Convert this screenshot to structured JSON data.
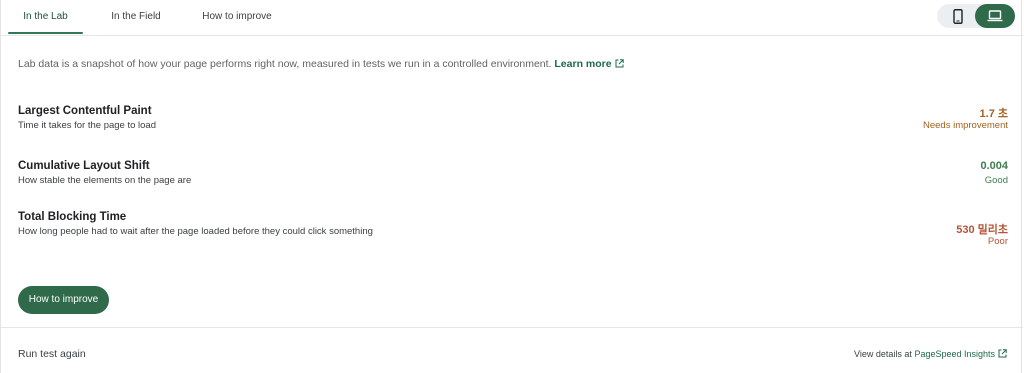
{
  "tabs": [
    {
      "label": "In the Lab",
      "active": true
    },
    {
      "label": "In the Field",
      "active": false
    },
    {
      "label": "How to improve",
      "active": false
    }
  ],
  "device_toggle": {
    "options": [
      {
        "icon": "smartphone-icon",
        "selected": false
      },
      {
        "icon": "laptop-icon",
        "selected": true
      }
    ]
  },
  "intro": {
    "text": "Lab data is a snapshot of how your page performs right now, measured in tests we run in a controlled environment.",
    "link_label": "Learn more",
    "link_icon": "external-link-icon"
  },
  "metrics": [
    {
      "title": "Largest Contentful Paint",
      "description": "Time it takes for the page to load",
      "value": "1.7 초",
      "status": "Needs improvement",
      "status_color": "#a5621e"
    },
    {
      "title": "Cumulative Layout Shift",
      "description": "How stable the elements on the page are",
      "value": "0.004",
      "status": "Good",
      "status_color": "#3e7d4f"
    },
    {
      "title": "Total Blocking Time",
      "description": "How long people had to wait after the page loaded before they could click something",
      "value": "530 밀리초",
      "status": "Poor",
      "status_color": "#b35537"
    }
  ],
  "improve_button": {
    "label": "How to improve"
  },
  "footer": {
    "run_again_label": "Run test again",
    "view_details_prefix": "View details at",
    "view_details_link": "PageSpeed Insights",
    "view_details_icon": "external-link-icon"
  },
  "colors": {
    "accent": "#2f6b4a",
    "link": "#1e6a49",
    "amber": "#a5621e",
    "green": "#3e7d4f",
    "red": "#b35537"
  }
}
